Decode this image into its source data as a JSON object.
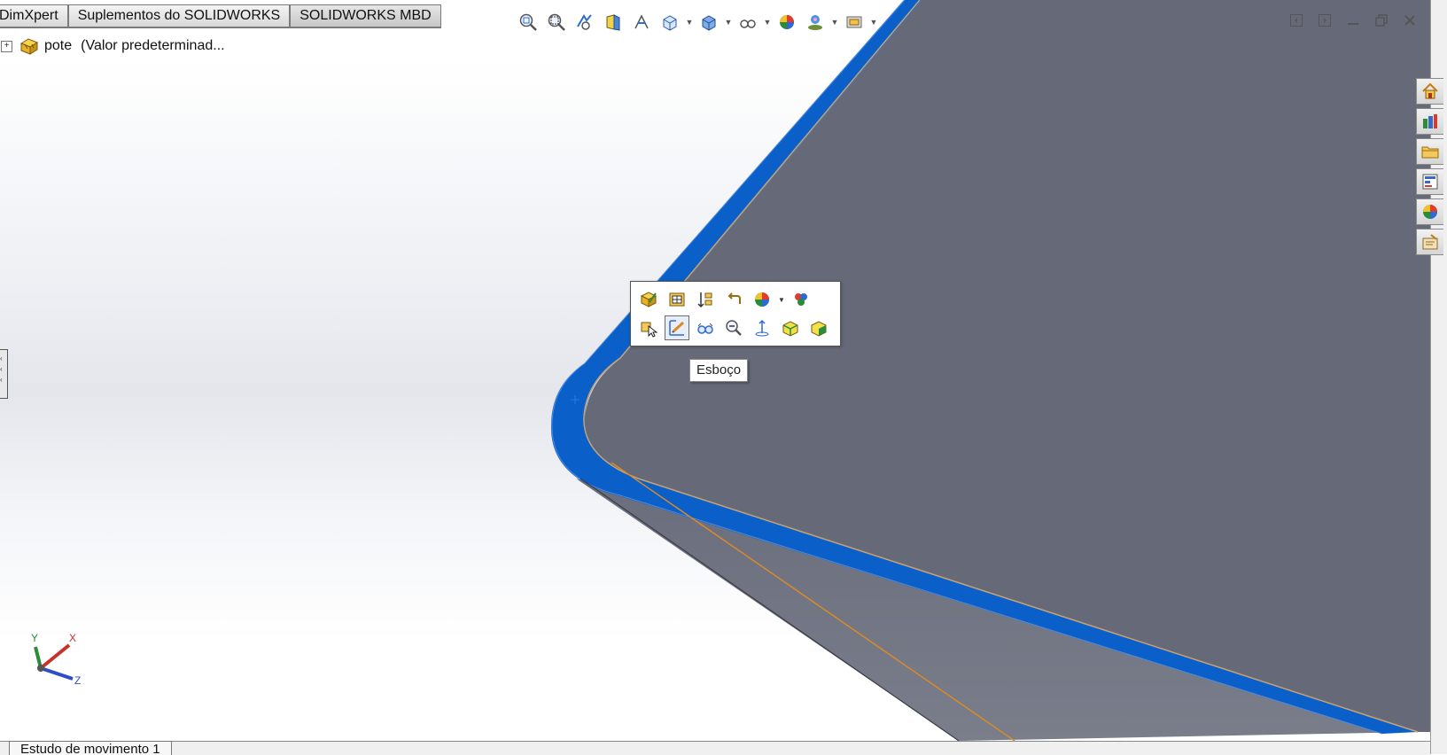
{
  "command_manager": {
    "tabs": [
      "DimXpert",
      "Suplementos do SOLIDWORKS",
      "SOLIDWORKS MBD"
    ]
  },
  "heads_up_toolbar": {
    "icons": [
      "zoom-to-fit-icon",
      "zoom-to-area-icon",
      "previous-view-icon",
      "section-view-icon",
      "dynamic-annotation-views-icon",
      "view-orientation-icon",
      "display-style-icon",
      "hide-show-items-icon",
      "edit-appearance-icon",
      "apply-scene-icon",
      "view-settings-icon"
    ]
  },
  "window_controls": {
    "icons": [
      "tile-left-icon",
      "tile-right-icon",
      "minimize-icon",
      "restore-icon",
      "close-icon"
    ]
  },
  "feature_tree": {
    "part_name": "pote",
    "configuration": "(Valor predeterminad..."
  },
  "context_toolbar": {
    "row1_icons": [
      "edit-feature-icon",
      "hide-show-bodies-icon",
      "rollback-icon",
      "undo-icon",
      "appearance-icon",
      "appearances-icon"
    ],
    "row2_icons": [
      "select-other-icon",
      "sketch-icon",
      "hide-show-icon",
      "zoom-to-selection-icon",
      "normal-to-icon",
      "isolate-icon",
      "hide-icon"
    ],
    "tooltip": "Esboço"
  },
  "task_pane": {
    "icons": [
      "solidworks-resources-icon",
      "design-library-icon",
      "file-explorer-icon",
      "view-palette-icon",
      "appearances-scenes-decals-icon",
      "custom-properties-icon"
    ]
  },
  "triad": {
    "x_label": "X",
    "y_label": "Y",
    "z_label": "Z"
  },
  "motion_study_tab": "Estudo de movimento 1",
  "colors": {
    "face_gray": "#666a78",
    "selected_edge_blue": "#0a5fc8",
    "silhouette_orange": "#d98a2a"
  }
}
